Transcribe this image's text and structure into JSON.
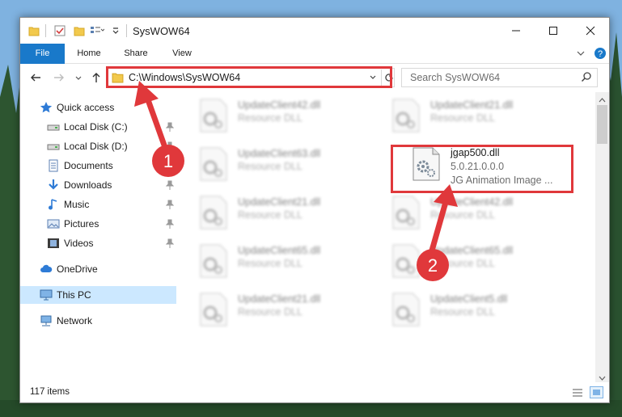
{
  "window": {
    "title": "SysWOW64"
  },
  "ribbon": {
    "tabs": [
      "File",
      "Home",
      "Share",
      "View"
    ]
  },
  "address": {
    "path": "C:\\Windows\\SysWOW64"
  },
  "search": {
    "placeholder": "Search SysWOW64"
  },
  "sidebar": {
    "items": [
      {
        "label": "Quick access",
        "icon": "star-icon"
      },
      {
        "label": "Local Disk (C:)",
        "icon": "drive-icon"
      },
      {
        "label": "Local Disk (D:)",
        "icon": "drive-icon"
      },
      {
        "label": "Documents",
        "icon": "documents-icon"
      },
      {
        "label": "Downloads",
        "icon": "download-icon"
      },
      {
        "label": "Music",
        "icon": "music-icon"
      },
      {
        "label": "Pictures",
        "icon": "pictures-icon"
      },
      {
        "label": "Videos",
        "icon": "videos-icon"
      },
      {
        "label": "OneDrive",
        "icon": "cloud-icon"
      },
      {
        "label": "This PC",
        "icon": "computer-icon"
      },
      {
        "label": "Network",
        "icon": "network-icon"
      }
    ]
  },
  "files": {
    "left": [
      {
        "name": "UpdateClient42.dll",
        "desc": "Resource DLL"
      },
      {
        "name": "UpdateClient63.dll",
        "desc": "Resource DLL"
      },
      {
        "name": "UpdateClient21.dll",
        "desc": "Resource DLL"
      },
      {
        "name": "UpdateClient65.dll",
        "desc": "Resource DLL"
      },
      {
        "name": "UpdateClient21.dll",
        "desc": "Resource DLL"
      }
    ],
    "right": [
      {
        "name": "UpdateClient21.dll",
        "desc": "Resource DLL"
      },
      {
        "name": "jgap500.dll",
        "version": "5.0.21.0.0.0",
        "desc": "JG Animation Image ..."
      },
      {
        "name": "UpdateClient42.dll",
        "desc": "Resource DLL"
      },
      {
        "name": "UpdateClient65.dll",
        "desc": "Resource DLL"
      },
      {
        "name": "UpdateClient5.dll",
        "desc": "Resource DLL"
      }
    ]
  },
  "status": {
    "item_count": "117 items"
  },
  "annotations": {
    "step1": "1",
    "step2": "2"
  },
  "colors": {
    "accent": "#1979ca",
    "annotation_red": "#e0383b",
    "selection": "#cce8ff"
  }
}
